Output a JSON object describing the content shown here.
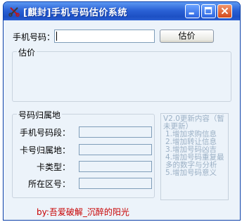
{
  "window": {
    "title": "[麒封]手机号码估价系统",
    "controls": {
      "minimize": "minimize",
      "maximize": "maximize",
      "close": "close"
    }
  },
  "query": {
    "phone_label": "手机号码：",
    "phone_value": "",
    "estimate_button": "估价"
  },
  "estimate_group": {
    "legend": "估价"
  },
  "location_group": {
    "legend": "号码归属地",
    "fields": [
      {
        "label": "手机号码段：",
        "value": ""
      },
      {
        "label": "卡号归属地：",
        "value": ""
      },
      {
        "label": "卡类型：",
        "value": ""
      },
      {
        "label": "所在区号：",
        "value": ""
      }
    ]
  },
  "update_notes": {
    "title": "V2.0更新内容（暂未更新）",
    "items": [
      "1.增加求购信息",
      "2.增加转让信息",
      "3.增加号码凶吉",
      "4.增加号码重复最多的数字与分析",
      "5.增加号码意义"
    ]
  },
  "credit": "by:吾爱破解_沉醉的阳光",
  "colors": {
    "titlebar": "#2b62d6",
    "client_bg": "#ecf3fa",
    "credit_text": "#c80000",
    "notes_text": "#9bb0c5"
  },
  "icons": {
    "app": "scissors-icon",
    "minimize": "minimize-icon",
    "maximize": "maximize-icon",
    "close": "close-icon"
  }
}
